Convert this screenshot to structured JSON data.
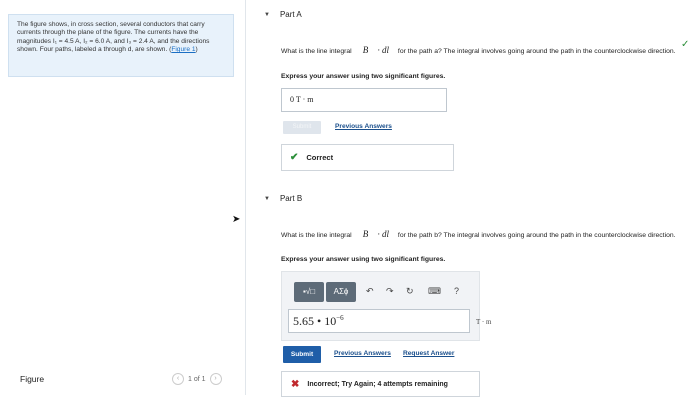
{
  "problem": {
    "intro": "The figure shows, in cross section, several conductors that carry currents through the plane of the figure. The currents have the magnitudes ",
    "i1": "I₁ = 4.5 A",
    "i2": "I₂ = 6.0 A",
    "i3": "I₃ = 2.4 A",
    "mid": ", and the directions shown. Four paths, labeled a through d, are shown. (",
    "link": "Figure 1",
    "end": ")"
  },
  "figure_bar": {
    "label": "Figure",
    "pager_text": "1 of 1",
    "prev_icon": "chevron-left-icon",
    "next_icon": "chevron-right-icon"
  },
  "part_a": {
    "title": "Part A",
    "question_pre": "What is the line integral ",
    "integral": "∮ B⃗ · dl⃗",
    "question_post": " for the path a? The integral involves going around the path in the counterclockwise direction.",
    "instruction": "Express your answer using two significant figures.",
    "answer": "0  T · m",
    "submit_label": "Submit",
    "prev_answers_label": "Previous Answers",
    "feedback": "Correct",
    "status_color": "#2c8f3a"
  },
  "part_b": {
    "title": "Part B",
    "question_pre": "What is the line integral ",
    "integral": "∮ B⃗ · dl⃗",
    "question_post": " for the path b? The integral involves going around the path in the counterclockwise direction.",
    "instruction": "Express your answer using two significant figures.",
    "toolbar": {
      "template_label": "▪√□",
      "symbols_label": "AΣϕ",
      "undo_icon": "undo-icon",
      "redo_icon": "redo-icon",
      "reset_icon": "reset-icon",
      "keyboard_icon": "keyboard-icon",
      "help_label": "?"
    },
    "answer_mantissa": "5.65 • 10",
    "answer_exponent": "−6",
    "units": "T · m",
    "submit_label": "Submit",
    "prev_answers_label": "Previous Answers",
    "request_answer_label": "Request Answer",
    "feedback": "Incorrect; Try Again; 4 attempts remaining",
    "error_color": "#c0282d"
  }
}
